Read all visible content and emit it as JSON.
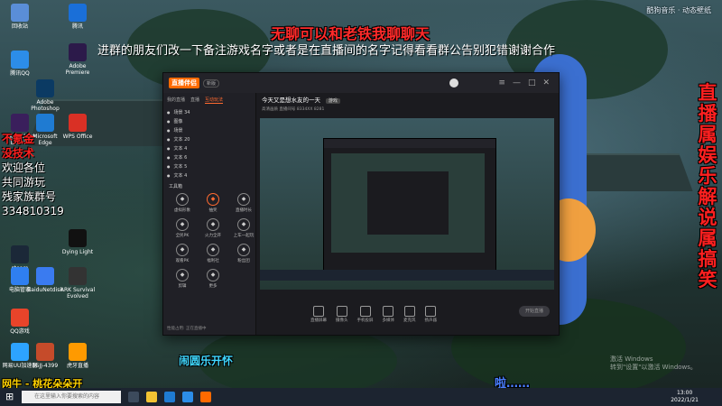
{
  "overlay": {
    "title_red": "无聊可以和老铁我聊聊天",
    "announcement": "进群的朋友们改一下备注游戏名字或者是在直播间的名字记得看看群公告别犯错谢谢合作",
    "left_lines": [
      {
        "text": "不氪金",
        "color": "#ff2020"
      },
      {
        "text": "没技术",
        "color": "#ff2020"
      },
      {
        "text": "欢迎各位",
        "color": "#ffffff"
      },
      {
        "text": "共同游玩",
        "color": "#ffffff"
      },
      {
        "text": "残家族群号",
        "color": "#ffffff"
      },
      {
        "text": "334810319",
        "color": "#ffffff"
      }
    ],
    "vertical_red": "直播属娱乐解说属搞笑",
    "bottom_left_song": "网牛 - 桃花朵朵开",
    "bottom_center_cyan": "闹圆乐开怀",
    "bottom_right_blue": "啦……",
    "watermark": "酷狗音乐 · 动态壁纸"
  },
  "desktop_icons": [
    {
      "label": "回收站",
      "icon": "recycle-bin-icon",
      "color": "#5a8ed8"
    },
    {
      "label": "腾讯QQ",
      "icon": "qq-icon",
      "color": "#2c8de8"
    },
    {
      "label": "Adobe Photoshop",
      "icon": "photoshop-icon",
      "color": "#0b3a63"
    },
    {
      "label": "Adobe After Effects",
      "icon": "after-effects-icon",
      "color": "#3a1f5c"
    },
    {
      "label": "Microsoft Edge",
      "icon": "edge-icon",
      "color": "#1f7bd2"
    },
    {
      "label": "steam",
      "icon": "steam-icon",
      "color": "#1b2838"
    },
    {
      "label": "电脑管家",
      "icon": "pc-manager-icon",
      "color": "#2f7ff0"
    },
    {
      "label": "QQ游戏",
      "icon": "qq-game-icon",
      "color": "#e8442a"
    },
    {
      "label": "网易UU加速器",
      "icon": "uu-icon",
      "color": "#2da3ff"
    },
    {
      "label": "腾讯",
      "icon": "tencent-icon",
      "color": "#1a6fd8"
    },
    {
      "label": "Adobe Premiere",
      "icon": "premiere-icon",
      "color": "#2c1a4a"
    },
    {
      "label": "WPS Office",
      "icon": "wps-icon",
      "color": "#d93025"
    },
    {
      "label": "BaiduNetdisk",
      "icon": "baidu-netdisk-icon",
      "color": "#3a7bf0"
    },
    {
      "label": "ARK Survival Evolved",
      "icon": "ark-icon",
      "color": "#333333"
    },
    {
      "label": "Dying Light",
      "icon": "dying-light-icon",
      "color": "#111111"
    },
    {
      "label": "SSJJ-4399",
      "icon": "ssjj-icon",
      "color": "#c54b2a"
    },
    {
      "label": "虎牙直播",
      "icon": "huya-icon",
      "color": "#ff9a00"
    }
  ],
  "app": {
    "logo": "直播伴侣",
    "version_badge": "新版",
    "tabs": [
      "我的直播",
      "直播",
      "互动玩法"
    ],
    "active_tab": "互动玩法",
    "scenes": [
      "场景 34",
      "图像",
      "场景",
      "文本 20",
      "文本 4",
      "文本 6",
      "文本 5",
      "文本 4"
    ],
    "tools_title": "工具箱",
    "tools": [
      {
        "label": "虚拟形象",
        "hot": false
      },
      {
        "label": "抽奖",
        "hot": true
      },
      {
        "label": "直播时长",
        "hot": false
      },
      {
        "label": "全民PK",
        "hot": false
      },
      {
        "label": "火力全开",
        "hot": false
      },
      {
        "label": "上车一起玩",
        "hot": false
      },
      {
        "label": "观看PK",
        "hot": false
      },
      {
        "label": "福利社",
        "hot": false
      },
      {
        "label": "粉丝团",
        "hot": false
      },
      {
        "label": "剪辑",
        "hot": false
      },
      {
        "label": "更多",
        "hot": false
      }
    ],
    "stream_title": "今天又是想水友的一天",
    "stream_tag": "游戏",
    "stream_meta": "高清画质  直播间号  8334XX  8281",
    "status_text": "性能占用: 正在直播中",
    "bottom_buttons": [
      "直播屏幕",
      "摄像头",
      "手机投屏",
      "多媒体",
      "麦克风",
      "扬声器"
    ],
    "start_button": "开始直播"
  },
  "taskbar": {
    "search_placeholder": "在这里输入你要搜索的内容",
    "time": "13:00",
    "date": "2022/1/21"
  },
  "windows_activation": {
    "line1": "激活 Windows",
    "line2": "转到\"设置\"以激活 Windows。"
  }
}
